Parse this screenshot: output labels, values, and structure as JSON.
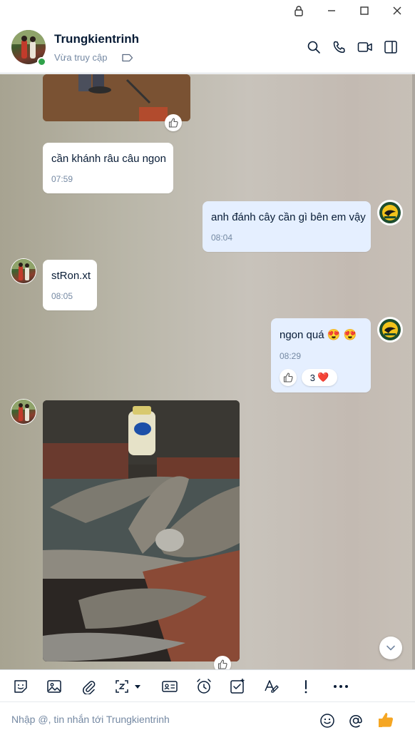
{
  "window": {
    "buttons": [
      "lock-icon",
      "minimize-icon",
      "maximize-icon",
      "close-icon"
    ]
  },
  "header": {
    "name": "Trungkientrinh",
    "status": "Vừa truy cập",
    "online_color": "#30a24a",
    "actions": [
      "search-icon",
      "phone-icon",
      "video-call-icon",
      "sidebar-toggle-icon"
    ]
  },
  "messages": [
    {
      "id": "m1",
      "sender": "them",
      "type": "image",
      "reaction": "like"
    },
    {
      "id": "m2",
      "sender": "them",
      "text": "cần khánh râu câu ngon",
      "time": "07:59"
    },
    {
      "id": "m3",
      "sender": "me",
      "text": "anh đánh cây cần gì bên em vậy",
      "time": "08:04"
    },
    {
      "id": "m4",
      "sender": "them",
      "text": "stRon.xt",
      "time": "08:05"
    },
    {
      "id": "m5",
      "sender": "me",
      "text": "ngon quá",
      "emoji": "😍 😍",
      "time": "08:29",
      "reaction_count": "3",
      "reaction_emoji": "❤️"
    },
    {
      "id": "m6",
      "sender": "them",
      "type": "image",
      "reaction": "like"
    }
  ],
  "toolbar": {
    "tools": [
      "sticker-icon",
      "image-icon",
      "attachment-icon",
      "screenshot-icon",
      "contact-card-icon",
      "reminder-icon",
      "task-icon",
      "text-format-icon",
      "urgent-icon",
      "more-icon"
    ]
  },
  "composer": {
    "placeholder": "Nhập @, tin nhắn tới Trungkientrinh",
    "value": ""
  },
  "colors": {
    "my_bubble": "#e5efff",
    "their_bubble": "#ffffff",
    "accent": "#0068ff",
    "like_button": "#f5a623"
  }
}
